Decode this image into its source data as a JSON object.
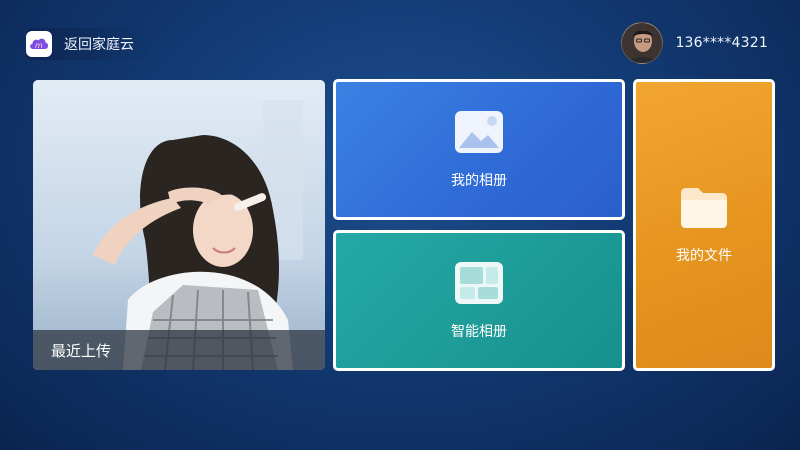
{
  "header": {
    "back_label": "返回家庭云",
    "logo_icon": "cloud-m-logo-icon",
    "account_phone": "136****4321"
  },
  "tiles": {
    "recent": {
      "label": "最近上传"
    },
    "album": {
      "label": "我的相册",
      "icon": "photo-landscape-icon",
      "color": "#2f6ad6"
    },
    "smart_album": {
      "label": "智能相册",
      "icon": "grid-album-icon",
      "color": "#1d9a96"
    },
    "files": {
      "label": "我的文件",
      "icon": "folder-icon",
      "color": "#e6951f"
    }
  },
  "colors": {
    "background": "#123a73",
    "tile_border": "#ffffff"
  }
}
